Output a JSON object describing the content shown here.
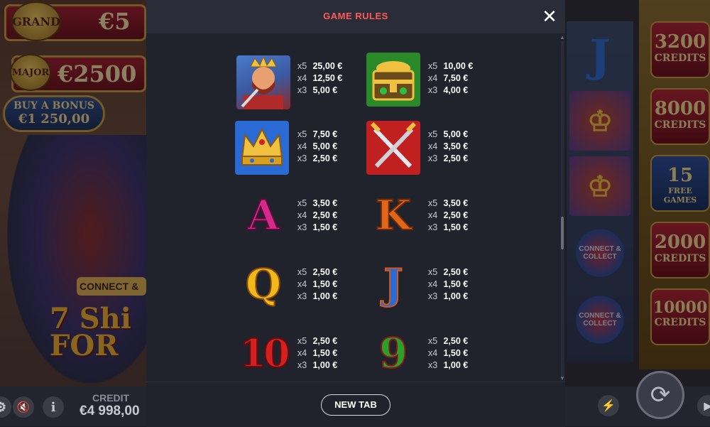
{
  "modal": {
    "title": "GAME RULES",
    "close_icon": "close-icon",
    "footer_button": "NEW TAB"
  },
  "paytable": [
    {
      "symbol": "king",
      "symbol_icon": "king-icon",
      "pays": [
        {
          "mult": "x5",
          "amount": "25,00 €"
        },
        {
          "mult": "x4",
          "amount": "12,50 €"
        },
        {
          "mult": "x3",
          "amount": "5,00 €"
        }
      ]
    },
    {
      "symbol": "treasure-chest",
      "symbol_icon": "treasure-chest-icon",
      "pays": [
        {
          "mult": "x5",
          "amount": "10,00 €"
        },
        {
          "mult": "x4",
          "amount": "7,50 €"
        },
        {
          "mult": "x3",
          "amount": "4,00 €"
        }
      ]
    },
    {
      "symbol": "crown",
      "symbol_icon": "crown-icon",
      "pays": [
        {
          "mult": "x5",
          "amount": "7,50 €"
        },
        {
          "mult": "x4",
          "amount": "5,00 €"
        },
        {
          "mult": "x3",
          "amount": "2,50 €"
        }
      ]
    },
    {
      "symbol": "crossed-swords",
      "symbol_icon": "crossed-swords-icon",
      "pays": [
        {
          "mult": "x5",
          "amount": "5,00 €"
        },
        {
          "mult": "x4",
          "amount": "3,50 €"
        },
        {
          "mult": "x3",
          "amount": "2,50 €"
        }
      ]
    },
    {
      "symbol": "A",
      "glyph": "A",
      "color": "#d42a8a",
      "pays": [
        {
          "mult": "x5",
          "amount": "3,50 €"
        },
        {
          "mult": "x4",
          "amount": "2,50 €"
        },
        {
          "mult": "x3",
          "amount": "1,50 €"
        }
      ]
    },
    {
      "symbol": "K",
      "glyph": "K",
      "color": "#e0661a",
      "pays": [
        {
          "mult": "x5",
          "amount": "3,50 €"
        },
        {
          "mult": "x4",
          "amount": "2,50 €"
        },
        {
          "mult": "x3",
          "amount": "1,50 €"
        }
      ]
    },
    {
      "symbol": "Q",
      "glyph": "Q",
      "color": "#f0b81a",
      "pays": [
        {
          "mult": "x5",
          "amount": "2,50 €"
        },
        {
          "mult": "x4",
          "amount": "1,50 €"
        },
        {
          "mult": "x3",
          "amount": "1,00 €"
        }
      ]
    },
    {
      "symbol": "J",
      "glyph": "J",
      "color": "#2a6ad4",
      "pays": [
        {
          "mult": "x5",
          "amount": "2,50 €"
        },
        {
          "mult": "x4",
          "amount": "1,50 €"
        },
        {
          "mult": "x3",
          "amount": "1,00 €"
        }
      ]
    },
    {
      "symbol": "10",
      "glyph": "10",
      "color": "#d42020",
      "pays": [
        {
          "mult": "x5",
          "amount": "2,50 €"
        },
        {
          "mult": "x4",
          "amount": "1,50 €"
        },
        {
          "mult": "x3",
          "amount": "1,00 €"
        }
      ]
    },
    {
      "symbol": "9",
      "glyph": "9",
      "color": "#2aa02a",
      "pays": [
        {
          "mult": "x5",
          "amount": "2,50 €"
        },
        {
          "mult": "x4",
          "amount": "1,50 €"
        },
        {
          "mult": "x3",
          "amount": "1,00 €"
        }
      ]
    }
  ],
  "background": {
    "jackpots": [
      {
        "name": "GRAND",
        "value": "€5"
      },
      {
        "name": "MAJOR",
        "value": "€2500"
      }
    ],
    "buy_bonus": {
      "line1": "BUY A BONUS",
      "line2": "€1 250,00"
    },
    "connect_label": "CONNECT &",
    "logo_text": "7 Shi\nFOR",
    "credit_label": "CREDIT",
    "credit_value": "€4 998,00",
    "reel_symbols": [
      "J",
      "king",
      "king",
      "CONNECT & COLLECT",
      "CONNECT & COLLECT"
    ],
    "credit_tiles": [
      {
        "big": "3200",
        "small": "CREDITS"
      },
      {
        "big": "8000",
        "small": "CREDITS"
      },
      {
        "big": "15",
        "small": "FREE GAMES"
      },
      {
        "big": "2000",
        "small": "CREDITS"
      },
      {
        "big": "10000",
        "small": "CREDITS"
      }
    ]
  },
  "colors": {
    "title_red": "#ff5a5a",
    "modal_bg": "#20222c",
    "header_bg": "#2a2c37"
  }
}
